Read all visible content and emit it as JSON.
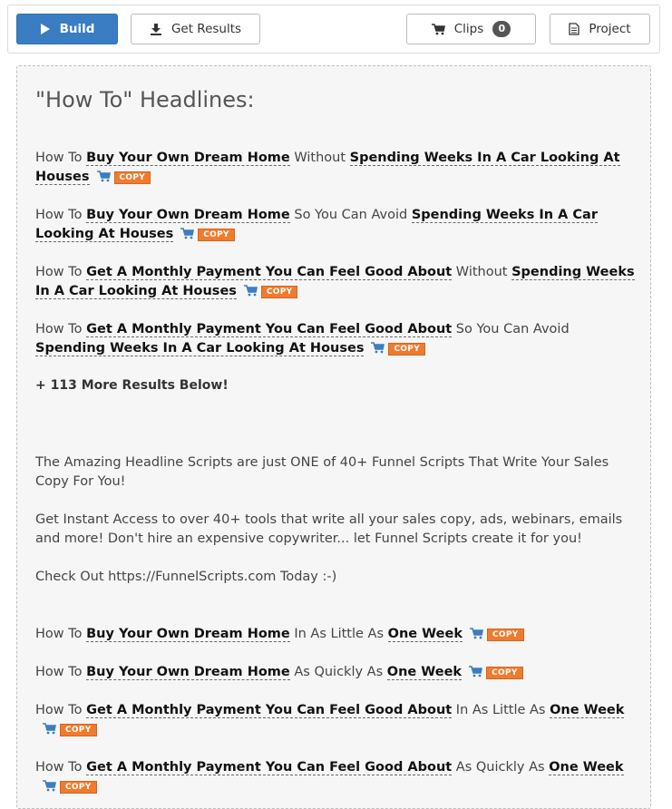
{
  "toolbar": {
    "build_label": "Build",
    "get_results_label": "Get Results",
    "clips_label": "Clips",
    "clips_count": "0",
    "project_label": "Project"
  },
  "panel": {
    "heading": "\"How To\" Headlines:",
    "copy_label": "COPY",
    "more_results": "+ 113 More Results Below!",
    "headlines_top": [
      {
        "p1": "How To ",
        "b1": "Buy Your Own Dream Home",
        "p2": " Without ",
        "b2": "Spending Weeks In A Car Looking At Houses"
      },
      {
        "p1": "How To ",
        "b1": "Buy Your Own Dream Home",
        "p2": " So You Can Avoid ",
        "b2": "Spending Weeks In A Car Looking At Houses"
      },
      {
        "p1": "How To ",
        "b1": "Get A Monthly Payment You Can Feel Good About",
        "p2": " Without ",
        "b2": "Spending Weeks In A Car Looking At Houses"
      },
      {
        "p1": "How To ",
        "b1": "Get A Monthly Payment You Can Feel Good About",
        "p2": " So You Can Avoid ",
        "b2": "Spending Weeks In A Car Looking At Houses"
      }
    ],
    "promo": [
      "The Amazing Headline Scripts are just ONE of 40+ Funnel Scripts That Write Your Sales Copy For You!",
      "Get Instant Access to over 40+ tools that write all your sales copy, ads, webinars, emails and more! Don't hire an expensive copywriter... let Funnel Scripts create it for you!",
      "Check Out https://FunnelScripts.com Today :-)"
    ],
    "headlines_bottom": [
      {
        "p1": "How To ",
        "b1": "Buy Your Own Dream Home",
        "p2": " In As Little As ",
        "b2": "One Week"
      },
      {
        "p1": "How To ",
        "b1": "Buy Your Own Dream Home",
        "p2": " As Quickly As ",
        "b2": "One Week"
      },
      {
        "p1": "How To ",
        "b1": "Get A Monthly Payment You Can Feel Good About",
        "p2": " In As Little As ",
        "b2": "One Week"
      },
      {
        "p1": "How To ",
        "b1": "Get A Monthly Payment You Can Feel Good About",
        "p2": " As Quickly As ",
        "b2": "One Week"
      }
    ]
  }
}
